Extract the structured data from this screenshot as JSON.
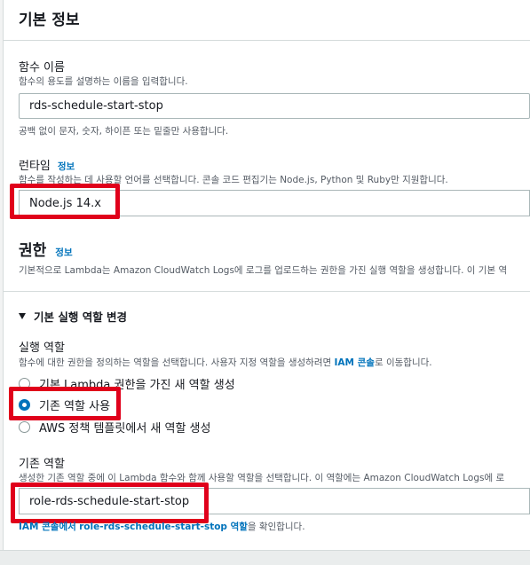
{
  "basic_info": {
    "title": "기본 정보"
  },
  "function_name": {
    "label": "함수 이름",
    "description": "함수의 용도를 설명하는 이름을 입력합니다.",
    "value": "rds-schedule-start-stop",
    "constraint": "공백 없이 문자, 숫자, 하이픈 또는 밑줄만 사용합니다."
  },
  "runtime": {
    "label": "런타임",
    "info": "정보",
    "description": "함수를 작성하는 데 사용할 언어를 선택합니다. 콘솔 코드 편집기는 Node.js, Python 및 Ruby만 지원합니다.",
    "value": "Node.js 14.x"
  },
  "permissions": {
    "title": "권한",
    "info": "정보",
    "description": "기본적으로 Lambda는 Amazon CloudWatch Logs에 로그를 업로드하는 권한을 가진 실행 역할을 생성합니다. 이 기본 역"
  },
  "change_role": {
    "toggle_label": "기본 실행 역할 변경",
    "execution_role_label": "실행 역할",
    "execution_role_desc_prefix": "함수에 대한 권한을 정의하는 역할을 선택합니다. 사용자 지정 역할을 생성하려면 ",
    "execution_role_desc_link": "IAM 콘솔",
    "execution_role_desc_suffix": "로 이동합니다.",
    "options": [
      {
        "label": "기본 Lambda 권한을 가진 새 역할 생성",
        "selected": false
      },
      {
        "label": "기존 역할 사용",
        "selected": true
      },
      {
        "label": "AWS 정책 템플릿에서 새 역할 생성",
        "selected": false
      }
    ]
  },
  "existing_role": {
    "label": "기존 역할",
    "description": "생성한 기존 역할 중에 이 Lambda 함수와 함께 사용할 역할을 선택합니다. 이 역할에는 Amazon CloudWatch Logs에 로",
    "value": "role-rds-schedule-start-stop",
    "footer_link1": "IAM 콘솔에서",
    "footer_link2": "role-rds-schedule-start-stop 역할",
    "footer_suffix": "을 확인합니다."
  },
  "colors": {
    "highlight": "#e0001b",
    "link": "#0073bb",
    "radio_selected": "#0073bb"
  }
}
